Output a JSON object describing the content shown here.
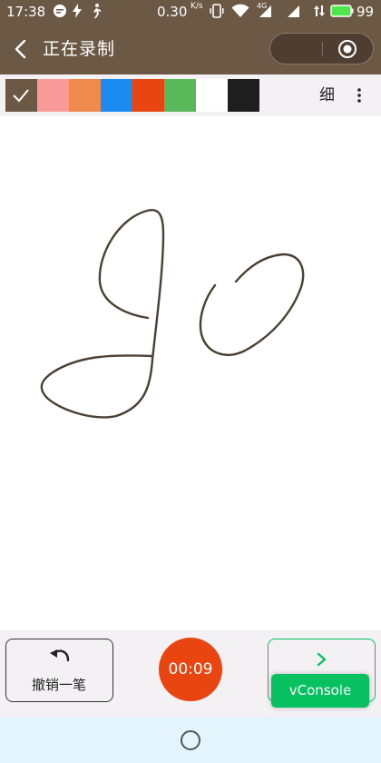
{
  "status_bar": {
    "time": "17:38",
    "speed": "0.30",
    "speed_unit": "K/s",
    "network": "4G",
    "battery": "99"
  },
  "nav": {
    "title": "正在录制"
  },
  "toolbar": {
    "colors": [
      "#6b5845",
      "#f89a98",
      "#f08a4c",
      "#1b8af1",
      "#e84511",
      "#58b85a",
      "#ffffff",
      "#1e1e1e"
    ],
    "selected_index": 0,
    "thickness_label": "细"
  },
  "bottom": {
    "undo_label": "撤销一笔",
    "timer": "00:09",
    "vconsole_label": "vConsole"
  },
  "theme": {
    "brand": "#6b5845",
    "record": "#e84511",
    "accent_green": "#07c160"
  }
}
